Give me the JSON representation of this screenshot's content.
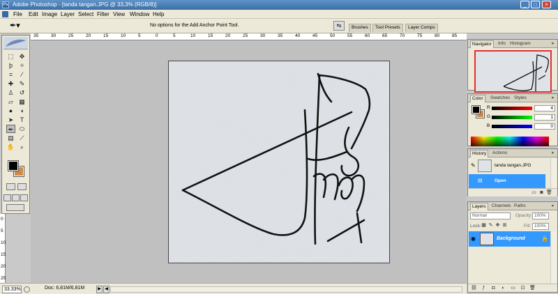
{
  "window": {
    "title": "Adobe Photoshop - [tanda tangan.JPG @ 33,3% (RGB/8)]",
    "minimize": "_",
    "maximize": "□",
    "close": "×",
    "app_badge": "Ps"
  },
  "menu": {
    "items": [
      "File",
      "Edit",
      "Image",
      "Layer",
      "Select",
      "Filter",
      "View",
      "Window",
      "Help"
    ]
  },
  "options_bar": {
    "tool_glyph": "✒▾",
    "message": "No options for the Add Anchor Point Tool.",
    "well_tabs": [
      "Brushes",
      "Tool Presets",
      "Layer Comps"
    ]
  },
  "ruler": {
    "h_labels": [
      "35",
      "30",
      "25",
      "20",
      "15",
      "10",
      "5",
      "0",
      "5",
      "10",
      "15",
      "20",
      "25",
      "30",
      "35",
      "40",
      "45",
      "50",
      "55",
      "60",
      "65",
      "70",
      "75",
      "80",
      "85"
    ],
    "v_labels": [
      "0",
      "5",
      "10",
      "15",
      "20",
      "25"
    ]
  },
  "status": {
    "zoom": "33.33%",
    "doc": "Doc: 6,81M/6,81M",
    "left_arrow": "◀",
    "right_arrow": "▶"
  },
  "navigator": {
    "tabs": [
      "Navigator",
      "Info",
      "Histogram"
    ]
  },
  "color": {
    "tabs": [
      "Color",
      "Swatches",
      "Styles"
    ],
    "channels": [
      {
        "label": "R",
        "value": "4",
        "gradient": "linear-gradient(90deg,#000,#f00)"
      },
      {
        "label": "G",
        "value": "1",
        "gradient": "linear-gradient(90deg,#000,#0f0)"
      },
      {
        "label": "B",
        "value": "0",
        "gradient": "linear-gradient(90deg,#000,#00f)"
      }
    ],
    "foreground": "#000000",
    "background": "#d08a45"
  },
  "history": {
    "tabs": [
      "History",
      "Actions"
    ],
    "snapshot": "tanda tangan.JPG",
    "states": [
      "Open"
    ]
  },
  "layers": {
    "tabs": [
      "Layers",
      "Channels",
      "Paths"
    ],
    "blend_mode": "Normal",
    "opacity_label": "Opacity:",
    "opacity": "100%",
    "lock_label": "Lock:",
    "fill_label": "Fill:",
    "fill": "100%",
    "layer_name": "Background"
  },
  "colors": {
    "titlebar": "#3a6ea5",
    "chrome": "#ece9d8",
    "selection": "#3399ff",
    "navigator_frame": "#e03030"
  }
}
